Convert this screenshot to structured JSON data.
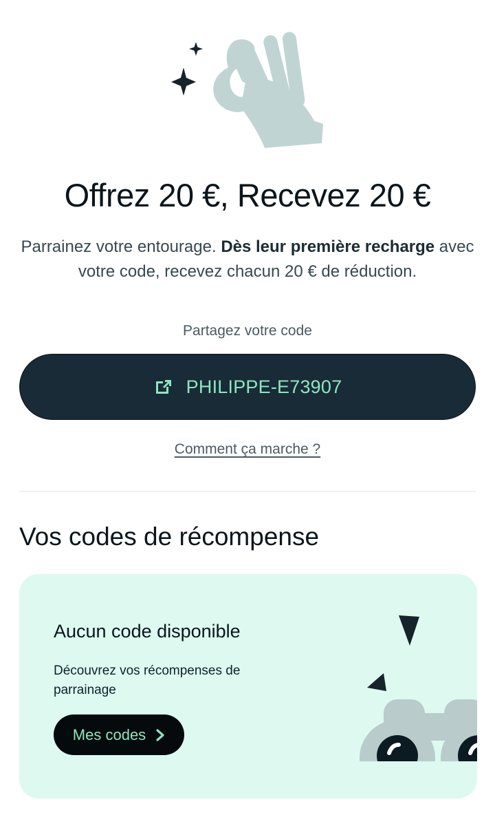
{
  "hero": {
    "illustration_icon": "ok-hand-sparkles-icon",
    "title": "Offrez 20 €, Recevez 20 €",
    "description_part1": "Parrainez votre entourage. ",
    "description_bold": "Dès leur première recharge",
    "description_part2": " avec votre code, recevez chacun 20 € de réduction."
  },
  "share": {
    "label": "Partagez votre code",
    "code": "PHILIPPE-E73907",
    "icon": "share-external-icon",
    "how_it_works": "Comment ça marche ?"
  },
  "rewards": {
    "section_title": "Vos codes de récompense",
    "card": {
      "title": "Aucun code disponible",
      "text": "Découvrez vos récompenses de parrainage",
      "button_label": "Mes codes",
      "button_icon": "chevron-right-icon",
      "illustration_icon": "binoculars-icon"
    }
  },
  "colors": {
    "primary_dark": "#182b37",
    "accent_green": "#8ee6bf",
    "card_bg": "#ddf9f0",
    "illustration_gray": "#c1d4d4"
  }
}
